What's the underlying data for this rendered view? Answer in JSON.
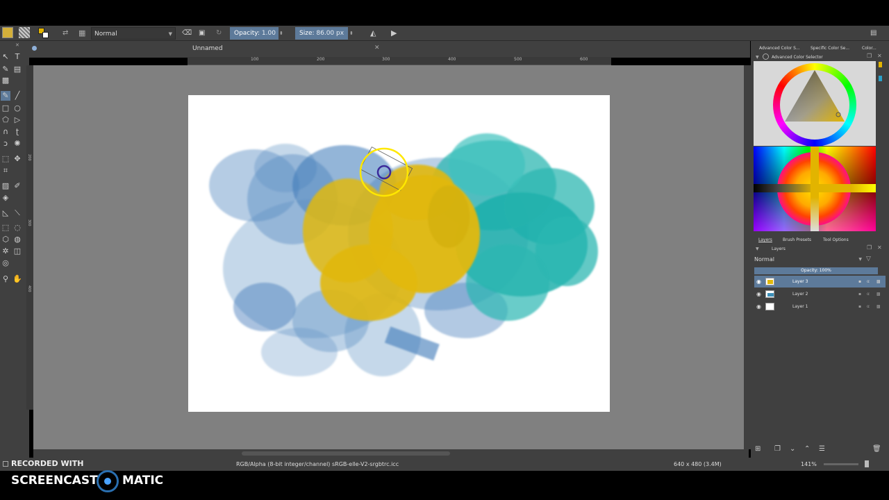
{
  "toolbar": {
    "blend_mode": "Normal",
    "opacity_label": "Opacity:",
    "opacity_value": "1.00",
    "size_label": "Size:",
    "size_value": "86.00 px"
  },
  "document": {
    "tab_title": "Unnamed"
  },
  "ruler": {
    "h_ticks": [
      "100",
      "200",
      "300",
      "400",
      "500",
      "600"
    ],
    "v_ticks": [
      "200",
      "300",
      "400"
    ]
  },
  "dock": {
    "tabs": [
      "Advanced Color S...",
      "Specific Color Se...",
      "Color..."
    ],
    "color_selector_title": "Advanced Color Selector",
    "lower_tabs": [
      "Layers",
      "Brush Presets",
      "Tool Options"
    ],
    "layers_title": "Layers",
    "layers_blend": "Normal",
    "layers_opacity": "Opacity:  100%",
    "layers": [
      "Layer 3",
      "Layer 2",
      "Layer 1"
    ]
  },
  "status": {
    "color_profile": "RGB/Alpha (8-bit integer/channel)  sRGB-elle-V2-srgbtrc.icc",
    "image_size": "640 x 480 (3.4M)",
    "zoom": "141%"
  },
  "watermark": {
    "recorded": "RECORDED WITH",
    "brand_left": "SCREENCAST",
    "brand_right": "MATIC"
  },
  "colors": {
    "accent": "#5d7a9a",
    "fg_color": "#e2b400",
    "paint_blue": "#5b8ec4",
    "paint_teal": "#2bb7b2",
    "paint_yellow": "#e1b80a"
  }
}
